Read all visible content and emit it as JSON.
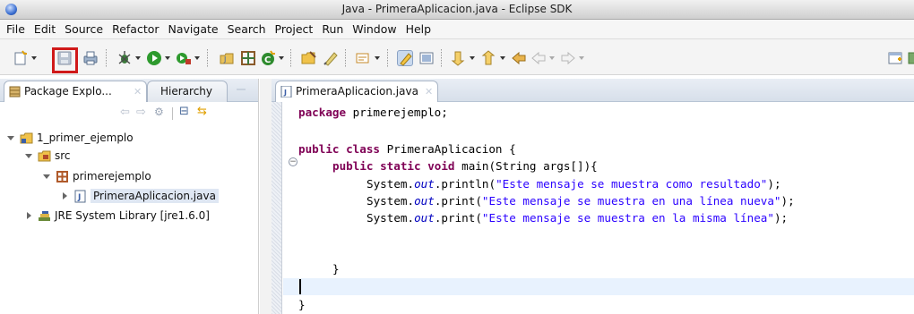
{
  "window": {
    "title": "Java - PrimeraAplicacion.java - Eclipse SDK"
  },
  "menu": [
    "File",
    "Edit",
    "Source",
    "Refactor",
    "Navigate",
    "Search",
    "Project",
    "Run",
    "Window",
    "Help"
  ],
  "toolbar": {
    "icons": [
      "new-icon",
      "save-icon",
      "print-icon",
      "debug-icon",
      "run-icon",
      "external-tools-icon",
      "open-type-icon",
      "open-task-icon",
      "new-java-class-icon",
      "open-folder-icon",
      "pen-icon",
      "annotation-icon",
      "toggle-mark-occurrences-icon",
      "show-whitespace-icon",
      "next-annotation-icon",
      "previous-annotation-icon",
      "last-edit-icon",
      "back-icon",
      "forward-icon",
      "open-perspective-icon"
    ],
    "highlighted": "save-icon",
    "highlight_color": "#d01919"
  },
  "left_panel": {
    "tabs": [
      {
        "label": "Package Explo...",
        "icon": "package-explorer-icon",
        "active": true
      },
      {
        "label": "Hierarchy",
        "icon": "",
        "active": false
      }
    ],
    "tree": [
      {
        "label": "1_primer_ejemplo",
        "icon": "project-folder-icon",
        "expanded": true
      },
      {
        "label": "src",
        "icon": "source-folder-icon",
        "expanded": true
      },
      {
        "label": "primerejemplo",
        "icon": "package-icon",
        "expanded": true
      },
      {
        "label": "PrimeraAplicacion.java",
        "icon": "java-file-icon",
        "expanded": false
      },
      {
        "label": "JRE System Library [jre1.6.0]",
        "icon": "library-icon",
        "expanded": false
      }
    ]
  },
  "editor": {
    "tab": {
      "label": "PrimeraAplicacion.java",
      "icon": "java-file-icon"
    },
    "code": {
      "l1_kw": "package",
      "l1_rest": " primerejemplo;",
      "l2_kw1": "public",
      "l2_kw2": "class",
      "l2_rest": " PrimeraAplicacion {",
      "l3_kw1": "public",
      "l3_kw2": "static",
      "l3_kw3": "void",
      "l3_rest": " main(String args[]){",
      "sys": "System.",
      "out": "out",
      "println": ".println(",
      "print": ".print(",
      "s1": "\"Este mensaje se muestra como resultado\"",
      "s2": "\"Este mensaje se muestra en una línea nueva\"",
      "s3": "\"Este mensaje se muestra en la misma línea\"",
      "end": ");",
      "brace_inner": "}",
      "brace_outer": "}"
    },
    "colors": {
      "keyword": "#7f0055",
      "string": "#2a00ff",
      "field": "#0000c0",
      "current_line": "#e8f2fe"
    }
  }
}
